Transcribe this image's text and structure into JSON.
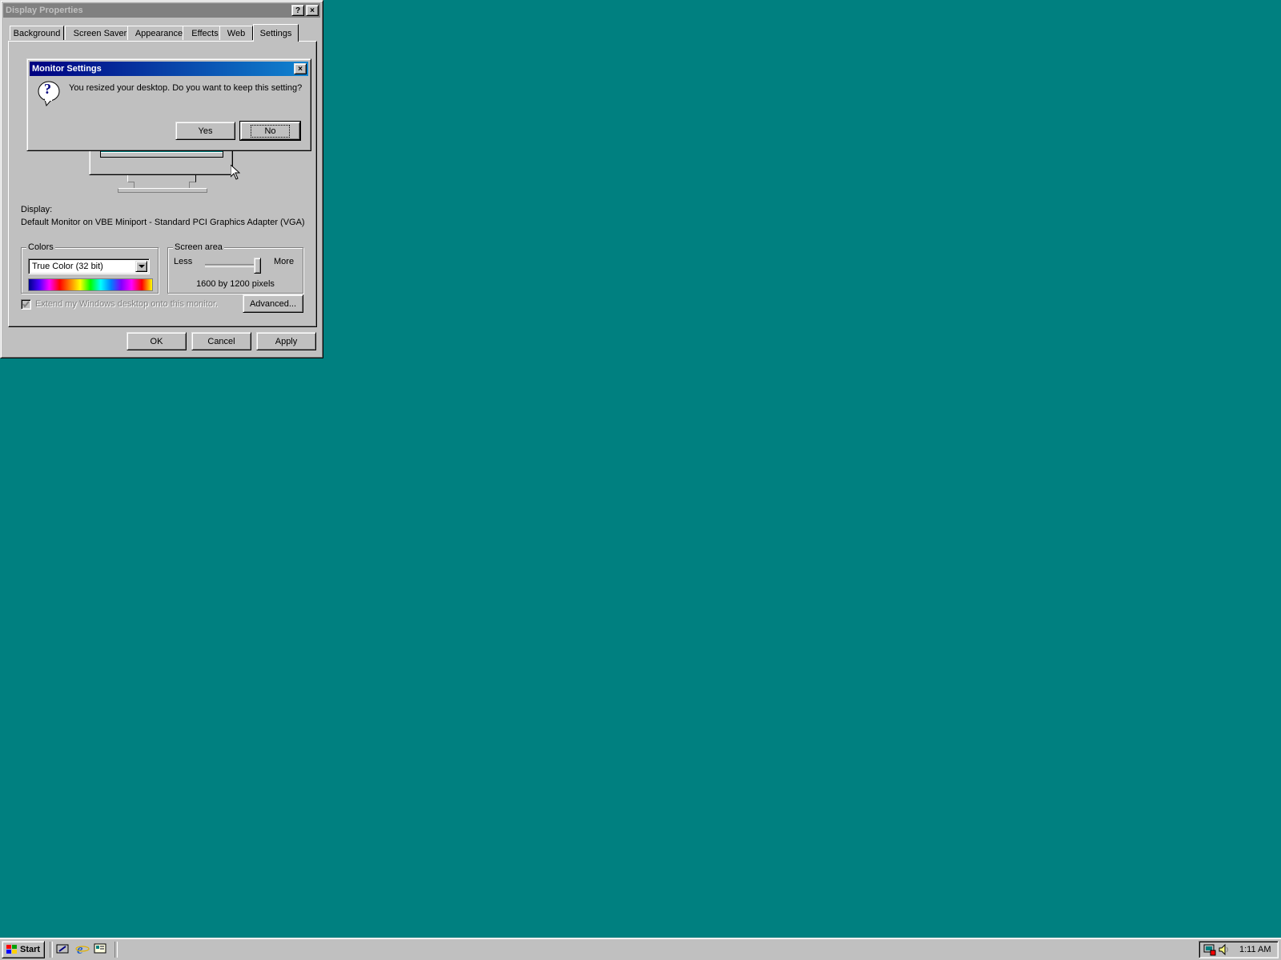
{
  "colors": {
    "desktop": "#008080",
    "face": "#c0c0c0",
    "title_active": "#000080",
    "title_inactive": "#808080"
  },
  "display_properties": {
    "title": "Display Properties",
    "help_icon": "?",
    "close_icon": "×",
    "tabs": [
      "Background",
      "Screen Saver",
      "Appearance",
      "Effects",
      "Web",
      "Settings"
    ],
    "active_tab": "Settings",
    "display_label": "Display:",
    "display_value": "Default Monitor on VBE Miniport - Standard PCI Graphics Adapter (VGA)",
    "colors_group": {
      "label": "Colors",
      "selected": "True Color (32 bit)"
    },
    "screen_area_group": {
      "label": "Screen area",
      "less": "Less",
      "more": "More",
      "slider_level": 1.0,
      "resolution": "1600 by 1200 pixels"
    },
    "extend_checkbox": {
      "label": "Extend my Windows desktop onto this monitor.",
      "checked": true,
      "disabled": true
    },
    "advanced_button": "Advanced...",
    "ok_button": "OK",
    "cancel_button": "Cancel",
    "apply_button": "Apply"
  },
  "monitor_settings": {
    "title": "Monitor Settings",
    "close_icon": "×",
    "question_icon": "?",
    "message": "You resized your desktop.  Do you want to keep this setting?",
    "yes_button": "Yes",
    "no_button": "No"
  },
  "taskbar": {
    "start_label": "Start",
    "quick_launch": [
      "show-desktop-icon",
      "internet-explorer-icon",
      "channels-icon"
    ],
    "tray_icons": [
      "display-settings-icon",
      "volume-icon"
    ],
    "clock": "1:11 AM"
  }
}
